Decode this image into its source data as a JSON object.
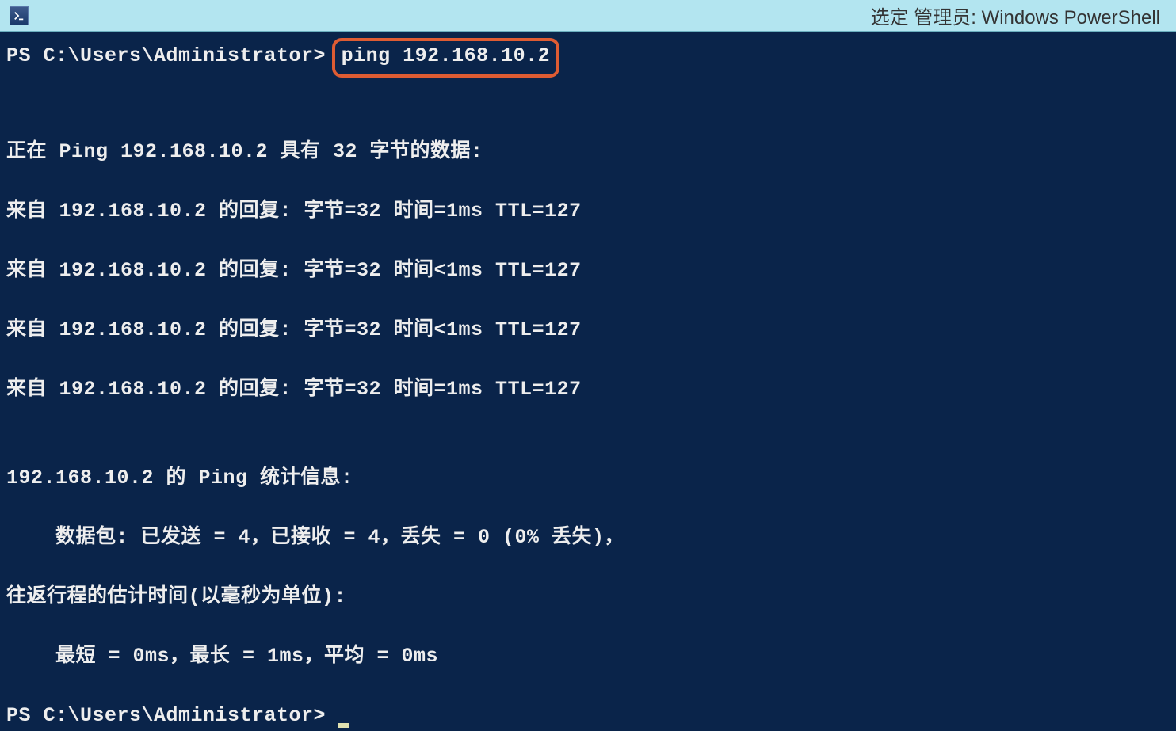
{
  "titlebar": {
    "title": "选定 管理员: Windows PowerShell"
  },
  "terminal": {
    "prompt1_prefix": "PS C:\\Users\\Administrator>",
    "highlighted_command": "ping 192.168.10.2",
    "line_header": "正在 Ping 192.168.10.2 具有 32 字节的数据:",
    "reply1": "来自 192.168.10.2 的回复: 字节=32 时间=1ms TTL=127",
    "reply2": "来自 192.168.10.2 的回复: 字节=32 时间<1ms TTL=127",
    "reply3": "来自 192.168.10.2 的回复: 字节=32 时间<1ms TTL=127",
    "reply4": "来自 192.168.10.2 的回复: 字节=32 时间=1ms TTL=127",
    "stats_header": "192.168.10.2 的 Ping 统计信息:",
    "stats_packets": "    数据包: 已发送 = 4，已接收 = 4，丢失 = 0 (0% 丢失)，",
    "stats_rtt_header": "往返行程的估计时间(以毫秒为单位):",
    "stats_rtt": "    最短 = 0ms，最长 = 1ms，平均 = 0ms",
    "prompt2": "PS C:\\Users\\Administrator> "
  }
}
